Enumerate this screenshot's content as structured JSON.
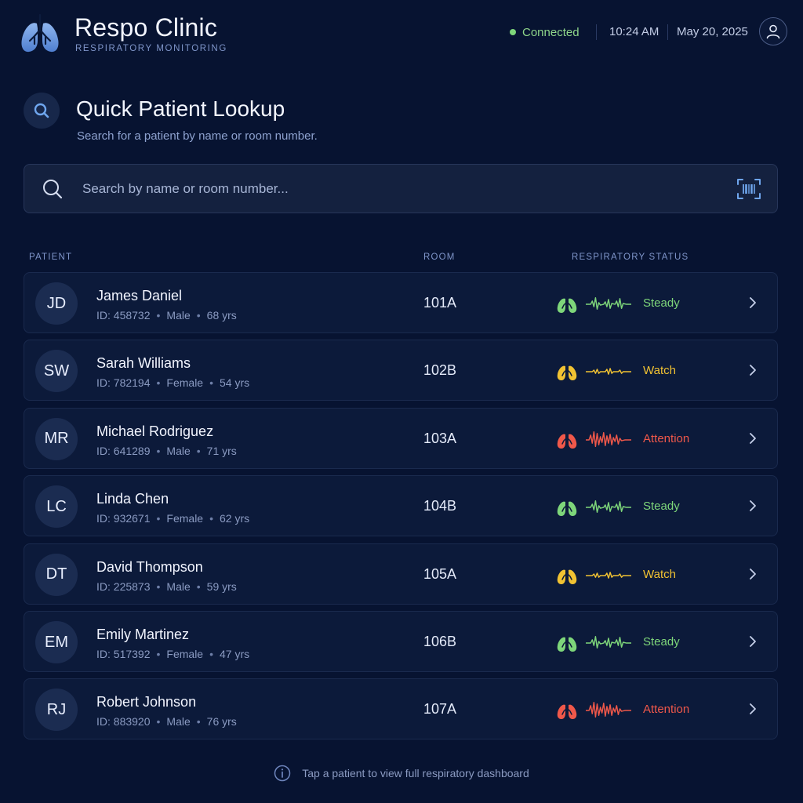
{
  "app": {
    "name": "Respo Clinic",
    "subtitle": "RESPIRATORY MONITORING",
    "connection": "Connected",
    "time": "10:24 AM",
    "date": "May 20, 2025"
  },
  "page": {
    "title": "Quick Patient Lookup",
    "subtitle": "Search for a patient by name or room number."
  },
  "search": {
    "placeholder": "Search by name or room number..."
  },
  "table": {
    "headers": {
      "patient": "PATIENT",
      "room": "ROOM",
      "status": "RESPIRATORY STATUS"
    }
  },
  "status_colors": {
    "Steady": "#7ed67a",
    "Watch": "#f1c232",
    "Attention": "#f0584a"
  },
  "patients": [
    {
      "initials": "JD",
      "name": "James Daniel",
      "id": "ID: 458732",
      "sex": "Male",
      "age": "68 yrs",
      "room": "101A",
      "status": "Steady"
    },
    {
      "initials": "SW",
      "name": "Sarah Williams",
      "id": "ID: 782194",
      "sex": "Female",
      "age": "54 yrs",
      "room": "102B",
      "status": "Watch"
    },
    {
      "initials": "MR",
      "name": "Michael Rodriguez",
      "id": "ID: 641289",
      "sex": "Male",
      "age": "71 yrs",
      "room": "103A",
      "status": "Attention"
    },
    {
      "initials": "LC",
      "name": "Linda Chen",
      "id": "ID: 932671",
      "sex": "Female",
      "age": "62 yrs",
      "room": "104B",
      "status": "Steady"
    },
    {
      "initials": "DT",
      "name": "David Thompson",
      "id": "ID: 225873",
      "sex": "Male",
      "age": "59 yrs",
      "room": "105A",
      "status": "Watch"
    },
    {
      "initials": "EM",
      "name": "Emily Martinez",
      "id": "ID: 517392",
      "sex": "Female",
      "age": "47 yrs",
      "room": "106B",
      "status": "Steady"
    },
    {
      "initials": "RJ",
      "name": "Robert Johnson",
      "id": "ID: 883920",
      "sex": "Male",
      "age": "76 yrs",
      "room": "107A",
      "status": "Attention"
    }
  ],
  "footer": {
    "hint": "Tap a patient to view full respiratory dashboard"
  }
}
